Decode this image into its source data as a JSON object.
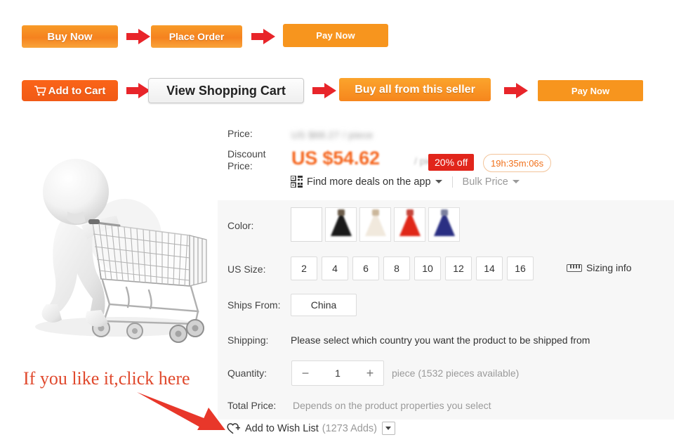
{
  "flow_row1": [
    {
      "label": "Buy Now",
      "name": "buy-now-button"
    },
    {
      "label": "Place Order",
      "name": "place-order-button"
    },
    {
      "label": "Pay Now",
      "name": "pay-now-button-1"
    }
  ],
  "flow_row2": [
    {
      "label": "Add to Cart",
      "icon": "cart-icon",
      "name": "add-to-cart-button"
    },
    {
      "label": "View Shopping Cart",
      "name": "view-shopping-cart-button"
    },
    {
      "label": "Buy all from this seller",
      "name": "buy-all-from-seller-button"
    },
    {
      "label": "Pay Now",
      "name": "pay-now-button-2"
    }
  ],
  "pricing": {
    "price_label": "Price:",
    "original_price": "US $68.27 / piece",
    "discount_label_line1": "Discount",
    "discount_label_line2": "Price:",
    "discount_price": "US $54.62",
    "discount_unit": "/ piece",
    "discount_badge": "20% off",
    "countdown": "19h:35m:06s",
    "app_deals": "Find more deals on the app",
    "bulk_price": "Bulk Price",
    "qr_icon": "qr-code-icon",
    "badge_color": "#e1251b",
    "price_color": "#f5651d"
  },
  "options": {
    "color_label": "Color:",
    "colors": [
      {
        "name": "blank",
        "hex": "#ffffff"
      },
      {
        "name": "black",
        "hex": "#1a1a1a"
      },
      {
        "name": "ivory",
        "hex": "#efe6da"
      },
      {
        "name": "red",
        "hex": "#e02718"
      },
      {
        "name": "navy",
        "hex": "#2a2f83"
      }
    ],
    "size_label": "US Size:",
    "sizes": [
      "2",
      "4",
      "6",
      "8",
      "10",
      "12",
      "14",
      "16"
    ],
    "sizing_info": "Sizing info",
    "sizing_icon": "ruler-icon",
    "ships_from_label": "Ships From:",
    "ships_from_value": "China",
    "shipping_label": "Shipping:",
    "shipping_value": "Please select which country you want the product to be shipped from",
    "quantity_label": "Quantity:",
    "quantity_value": "1",
    "quantity_minus": "−",
    "quantity_plus": "+",
    "quantity_note": "piece (1532 pieces available)",
    "total_price_label": "Total Price:",
    "total_price_value": "Depends on the product properties you select"
  },
  "wishlist": {
    "label": "Add to Wish List",
    "count": "(1273 Adds)",
    "heart_icon": "heart-plus-icon",
    "dropdown_icon": "chevron-down-icon"
  },
  "annotation": {
    "text": "If you like it,click here",
    "color": "#e0492d",
    "arrow": "red-arrow-pointer"
  }
}
